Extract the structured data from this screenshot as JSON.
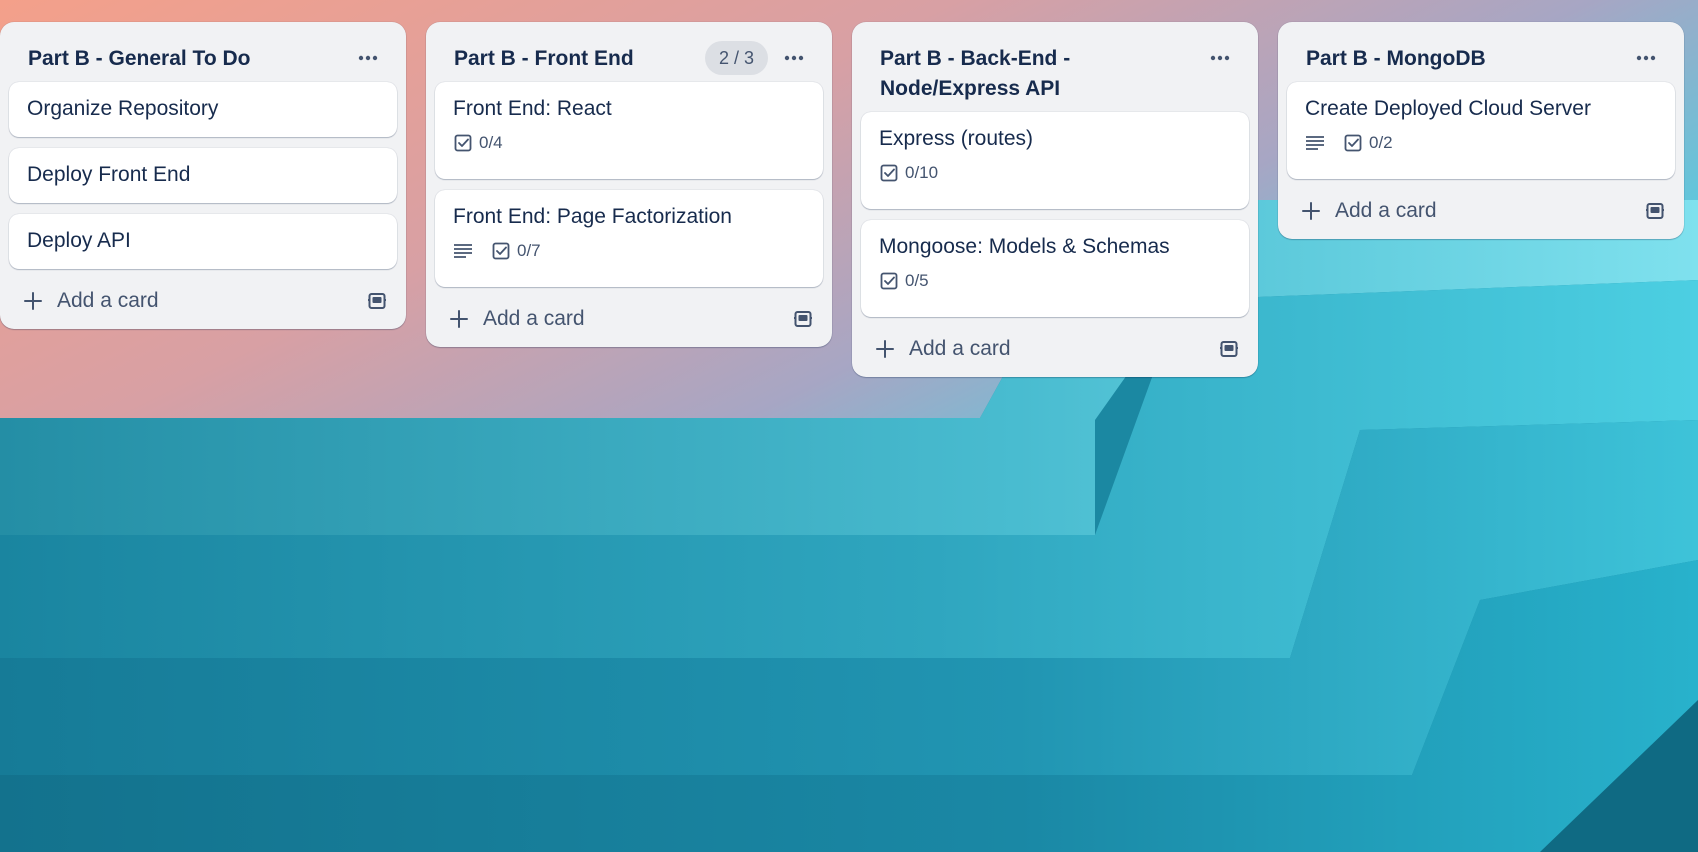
{
  "colors": {
    "list_bg": "#f1f2f4",
    "card_bg": "#ffffff",
    "title_text": "#172b4d",
    "muted_text": "#44546f",
    "badge_bg": "#dcdfe4"
  },
  "lists": [
    {
      "title": "Part B - General To Do",
      "badge": "",
      "menu_icon": "ellipsis-icon",
      "cards": [
        {
          "title": "Organize Repository"
        },
        {
          "title": "Deploy Front End"
        },
        {
          "title": "Deploy API"
        }
      ],
      "add_label": "Add a card"
    },
    {
      "title": "Part B - Front End",
      "badge": "2 / 3",
      "menu_icon": "ellipsis-icon",
      "cards": [
        {
          "title": "Front End: React",
          "checklist": "0/4"
        },
        {
          "title": "Front End: Page Factorization",
          "checklist": "0/7",
          "has_description": true
        }
      ],
      "add_label": "Add a card"
    },
    {
      "title": "Part B - Back-End - Node/Express API",
      "badge": "",
      "menu_icon": "ellipsis-icon",
      "cards": [
        {
          "title": "Express (routes)",
          "checklist": "0/10"
        },
        {
          "title": "Mongoose: Models & Schemas",
          "checklist": "0/5"
        }
      ],
      "add_label": "Add a card"
    },
    {
      "title": "Part B - MongoDB",
      "badge": "",
      "menu_icon": "ellipsis-icon",
      "cards": [
        {
          "title": "Create Deployed Cloud Server",
          "checklist": "0/2",
          "has_description": true
        }
      ],
      "add_label": "Add a card"
    }
  ]
}
